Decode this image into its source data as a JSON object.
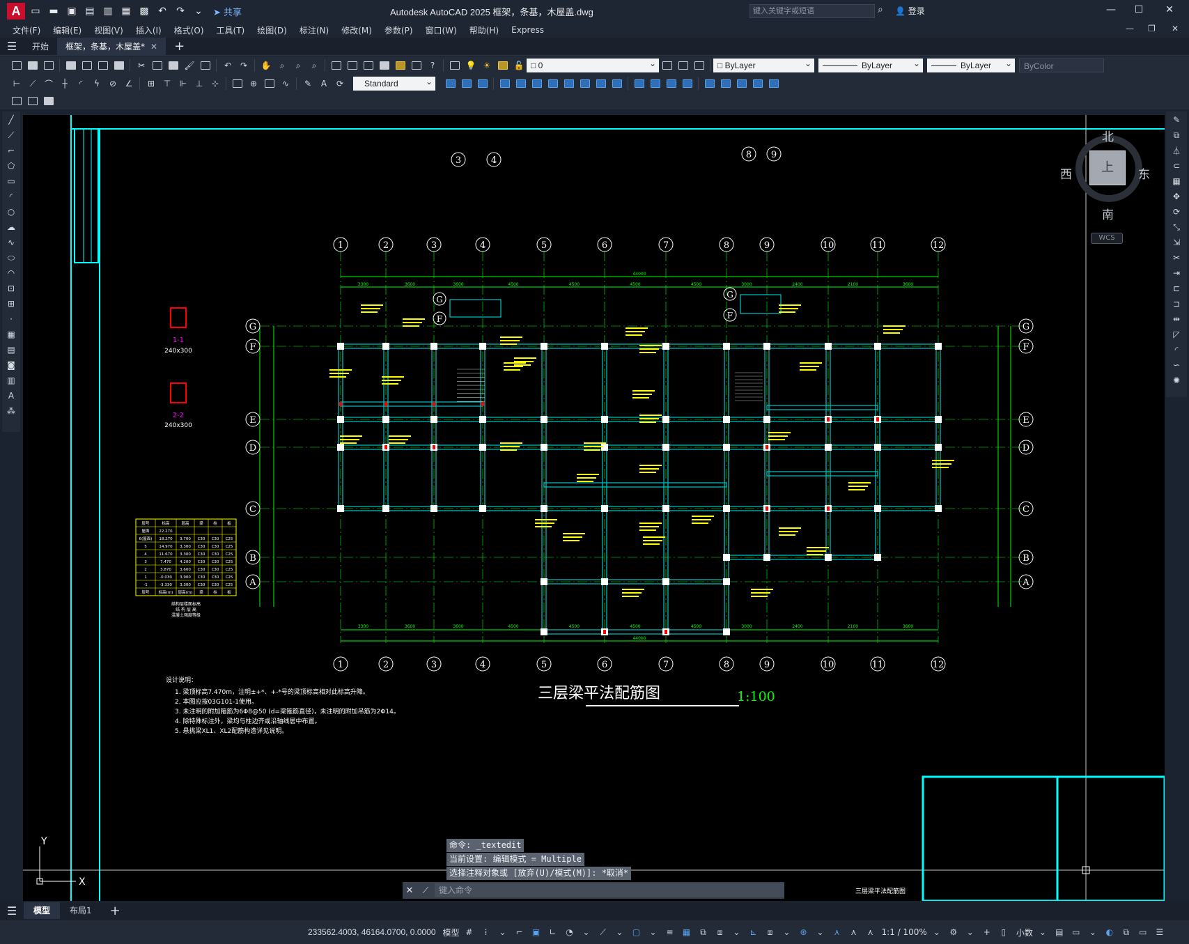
{
  "app": {
    "logo_letter": "A",
    "title": "Autodesk AutoCAD 2025    框架，条基，木屋盖.dwg",
    "share_label": "共享",
    "search_placeholder": "键入关键字或短语",
    "login_label": "登录",
    "window_controls": [
      "—",
      "☐",
      "✕"
    ]
  },
  "menu": [
    "文件(F)",
    "编辑(E)",
    "视图(V)",
    "插入(I)",
    "格式(O)",
    "工具(T)",
    "绘图(D)",
    "标注(N)",
    "修改(M)",
    "参数(P)",
    "窗口(W)",
    "帮助(H)",
    "Express"
  ],
  "doc_tabs": [
    {
      "label": "开始",
      "active": false
    },
    {
      "label": "框架，条基，木屋盖*",
      "active": true
    }
  ],
  "toolbar": {
    "layer_value": "0",
    "color_value": "ByLayer",
    "linetype_value": "ByLayer",
    "lineweight_value": "ByLayer",
    "plotstyle_value": "ByColor",
    "textstyle_value": "Standard"
  },
  "viewcube": {
    "north": "北",
    "south": "南",
    "east": "东",
    "west": "西",
    "face": "上",
    "wcs": "WCS"
  },
  "drawing": {
    "title": "三层梁平法配筋图",
    "scale": "1:100",
    "axis_numbers": [
      "1",
      "2",
      "3",
      "4",
      "5",
      "6",
      "7",
      "8",
      "9",
      "10",
      "11",
      "12"
    ],
    "axis_letters": [
      "G",
      "F",
      "E",
      "D",
      "C",
      "B",
      "A"
    ],
    "total_width": "44000",
    "top_spans": [
      "3300",
      "3600",
      "3600",
      "4500",
      "4500",
      "4500",
      "4500",
      "3000",
      "2400",
      "2100",
      "3600",
      "4500"
    ],
    "section_1": {
      "label": "1-1",
      "size": "240x300"
    },
    "section_2": {
      "label": "2-2",
      "size": "240x300"
    },
    "notes_title": "设计说明：",
    "notes": [
      "1. 梁顶标高7.470m，注明±+*、+-*号的梁顶标高相对此标高升降。",
      "2. 本图应按03G101-1使用。",
      "3. 未注明的附加箍筋为6Φ8@50 (d=梁箍筋直径)，未注明的附加吊筋为2Φ14。",
      "4. 除特殊标注外，梁均与柱边齐或沿轴线居中布置。",
      "5. 悬挑梁XL1、XL2配筋构造详见说明。"
    ],
    "table": {
      "header": [
        "层号",
        "标高",
        "层高",
        "梁",
        "柱",
        "板"
      ],
      "rows": [
        [
          "屋面",
          "22.270",
          "",
          "",
          "",
          ""
        ],
        [
          "6(屋面)",
          "18.270",
          "3.700",
          "C30",
          "C30",
          "C25"
        ],
        [
          "5",
          "14.970",
          "3.300",
          "C30",
          "C30",
          "C25"
        ],
        [
          "4",
          "11.670",
          "3.300",
          "C30",
          "C30",
          "C25"
        ],
        [
          "3",
          "7.470",
          "4.200",
          "C30",
          "C30",
          "C25"
        ],
        [
          "2",
          "3.870",
          "3.600",
          "C30",
          "C30",
          "C25"
        ],
        [
          "1",
          "-0.030",
          "3.900",
          "C30",
          "C30",
          "C25"
        ],
        [
          "-1",
          "-3.330",
          "3.300",
          "C30",
          "C30",
          "C25"
        ],
        [
          "层号",
          "标高(m)",
          "层高(m)",
          "梁",
          "柱",
          "板"
        ]
      ],
      "caption": "结构层楼面标高\n结 构 层 高\n混凝土强度等级"
    },
    "titleblock_name": "三层梁平法配筋图"
  },
  "command": {
    "history": [
      "命令: _textedit",
      "当前设置: 编辑模式 = Multiple",
      "选择注释对象或 [放弃(U)/模式(M)]: *取消*"
    ],
    "placeholder": "键入命令"
  },
  "layout_tabs": [
    {
      "label": "模型",
      "active": true
    },
    {
      "label": "布局1",
      "active": false
    }
  ],
  "status": {
    "coordinates": "233562.4003, 46164.0700, 0.0000",
    "model_label": "模型",
    "annotation_scale": "1:1 / 100%",
    "units": "小数"
  },
  "colors": {
    "canvas": "#000000",
    "frame_cyan": "#00ffff",
    "dim_green": "#00ff00",
    "text_yellow": "#ffff00",
    "beam_cyan": "#00c8c8",
    "column_white": "#ffffff",
    "accent_blue": "#5aa3f0"
  }
}
